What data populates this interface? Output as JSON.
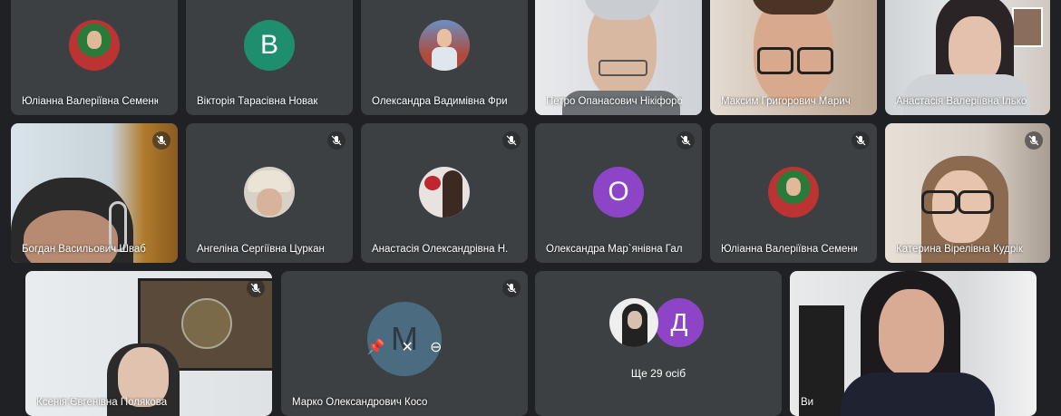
{
  "participants": [
    {
      "name": "Юліанна Валеріївна Семенюк",
      "type": "avatar-photo",
      "avatar_color": "#5b3a2a"
    },
    {
      "name": "Вікторія Тарасівна Новак",
      "type": "avatar-letter",
      "letter": "В",
      "avatar_color": "#1e8e6e"
    },
    {
      "name": "Олександра Вадимівна Фри...",
      "type": "avatar-photo",
      "avatar_color": "#4a6fa5"
    },
    {
      "name": "Петро Опанасович Нікіфоров",
      "type": "video",
      "speaking": true
    },
    {
      "name": "Максим Григорович Марич",
      "type": "video"
    },
    {
      "name": "Анастасія Валеріївна Ілько",
      "type": "video"
    },
    {
      "name": "Богдан Васильович Шваб",
      "type": "video",
      "muted": true
    },
    {
      "name": "Ангеліна Сергіївна Цуркан",
      "type": "avatar-photo",
      "muted": true,
      "avatar_color": "#d7d2c5"
    },
    {
      "name": "Анастасія Олександрівна Н...",
      "type": "avatar-photo",
      "muted": true,
      "avatar_color": "#e8e3de"
    },
    {
      "name": "Олександра Мар`янівна Галі...",
      "type": "avatar-letter",
      "letter": "О",
      "muted": true,
      "avatar_color": "#8e44c6"
    },
    {
      "name": "Юліанна Валеріївна Семенюк",
      "type": "avatar-photo",
      "muted": true,
      "avatar_color": "#5b3a2a"
    },
    {
      "name": "Катерина Вірелівна Кудрік",
      "type": "video",
      "muted": true
    },
    {
      "name": "Ксенія Євгенівна Полякова",
      "type": "video",
      "muted": true
    },
    {
      "name": "Марко Олександрович Косован",
      "type": "avatar-letter",
      "letter": "М",
      "muted": true,
      "avatar_color": "#4b6b80"
    },
    {
      "name": "Ви",
      "type": "video"
    }
  ],
  "more": {
    "text": "Ще 29 осіб",
    "letter": "Д",
    "letter_color": "#8e44c6"
  }
}
